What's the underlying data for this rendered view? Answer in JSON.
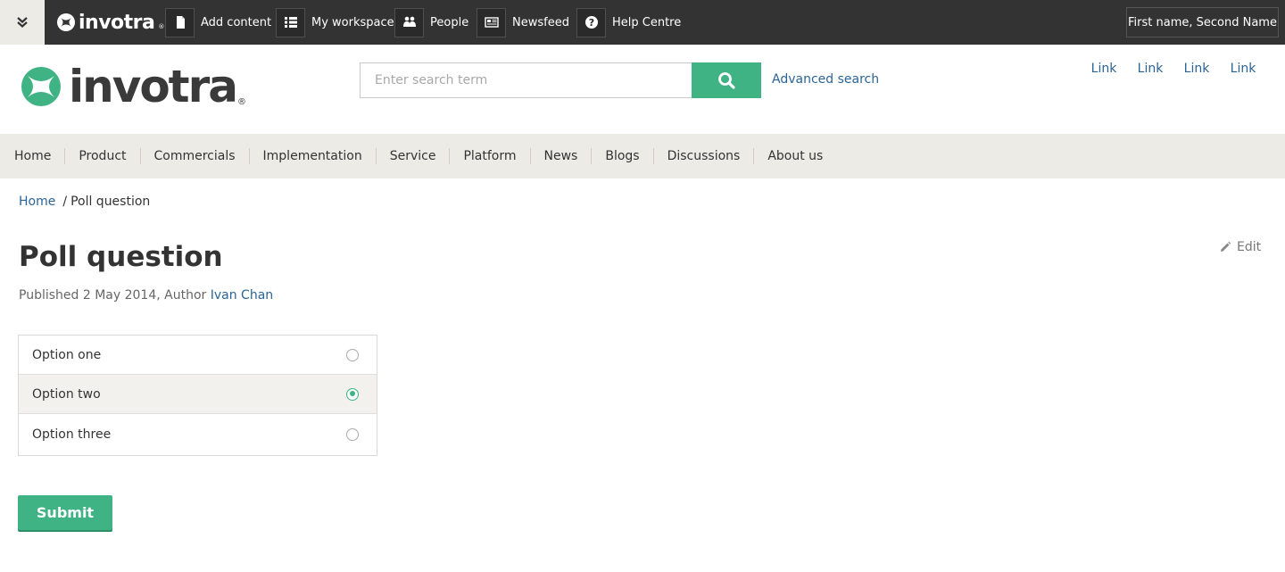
{
  "topbar": {
    "brand": "invotra",
    "tools": [
      {
        "label": "Add content",
        "icon": "document-icon"
      },
      {
        "label": "My workspace",
        "icon": "list-icon"
      },
      {
        "label": "People",
        "icon": "people-icon"
      },
      {
        "label": "Newsfeed",
        "icon": "newspaper-icon"
      },
      {
        "label": "Help Centre",
        "icon": "question-icon"
      }
    ],
    "user_name": "First name, Second Name"
  },
  "header": {
    "brand": "invotra",
    "search_placeholder": "Enter search term",
    "advanced_search": "Advanced search",
    "links": [
      "Link",
      "Link",
      "Link",
      "Link"
    ]
  },
  "nav": [
    "Home",
    "Product",
    "Commercials",
    "Implementation",
    "Service",
    "Platform",
    "News",
    "Blogs",
    "Discussions",
    "About us"
  ],
  "breadcrumb": {
    "home": "Home",
    "separator": "/",
    "current": "Poll question"
  },
  "page": {
    "title": "Poll question",
    "edit_label": "Edit",
    "meta_prefix": "Published 2 May 2014, Author",
    "author": "Ivan Chan"
  },
  "poll": {
    "options": [
      {
        "label": "Option one",
        "selected": false
      },
      {
        "label": "Option two",
        "selected": true
      },
      {
        "label": "Option three",
        "selected": false
      }
    ],
    "submit_label": "Submit"
  },
  "colors": {
    "accent": "#3fb383",
    "link": "#2a6496",
    "topbar": "#333333",
    "nav_bg": "#ecebe6"
  }
}
